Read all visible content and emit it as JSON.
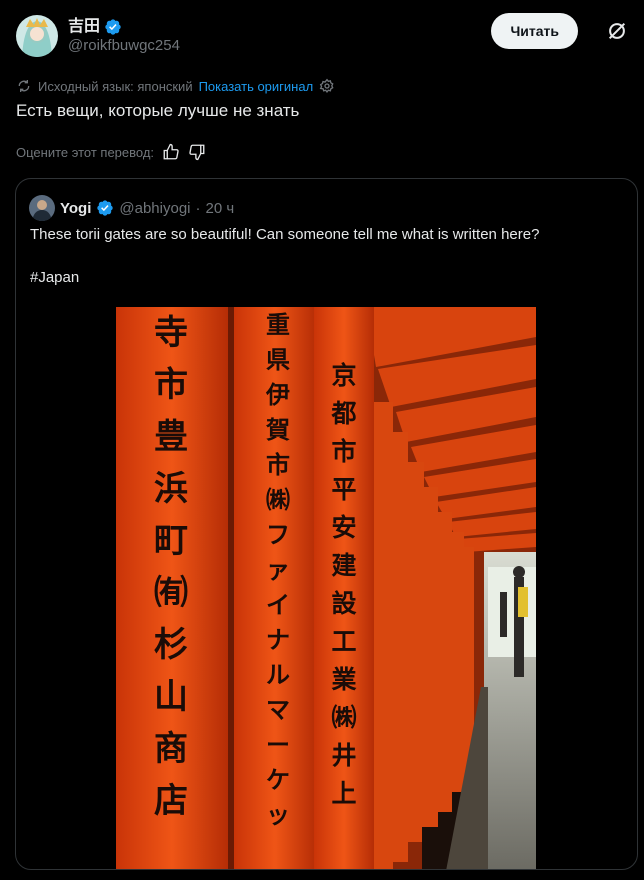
{
  "header": {
    "display_name": "吉田",
    "handle": "@roikfbuwgc254",
    "follow_label": "Читать"
  },
  "translation": {
    "source_language": "Исходный язык: японский",
    "show_original": "Показать оригинал"
  },
  "tweet": {
    "text": "Есть вещи, которые лучше не знать",
    "rate_prompt": "Оцените этот перевод:"
  },
  "quote": {
    "name": "Yogi",
    "handle": "@abhiyogi",
    "separator": "·",
    "time": "20 ч",
    "text": "These torii gates are so beautiful! Can someone tell me what is written here?",
    "hashtag": "#Japan"
  },
  "photo": {
    "pillar1": [
      "寺",
      "市",
      "豊",
      "浜",
      "町",
      "㈲",
      "杉",
      "山",
      "商",
      "店"
    ],
    "pillar2": [
      "重",
      "県",
      "伊",
      "賀",
      "市",
      "㈱",
      "フ",
      "ァ",
      "イ",
      "ナ",
      "ル",
      "マ",
      "ー",
      "ケ",
      "ッ"
    ],
    "pillar3": [
      "京",
      "都",
      "市",
      "平",
      "安",
      "建",
      "設",
      "工",
      "業",
      "㈱",
      "井",
      "上"
    ]
  },
  "colors": {
    "accent": "#1d9bf0",
    "torii": "#e8480f"
  },
  "icons": {
    "verified": "verified-badge-icon",
    "grok": "grok-icon",
    "translate": "translate-icon",
    "settings": "gear-icon",
    "thumbs_up": "thumbs-up-icon",
    "thumbs_down": "thumbs-down-icon"
  }
}
